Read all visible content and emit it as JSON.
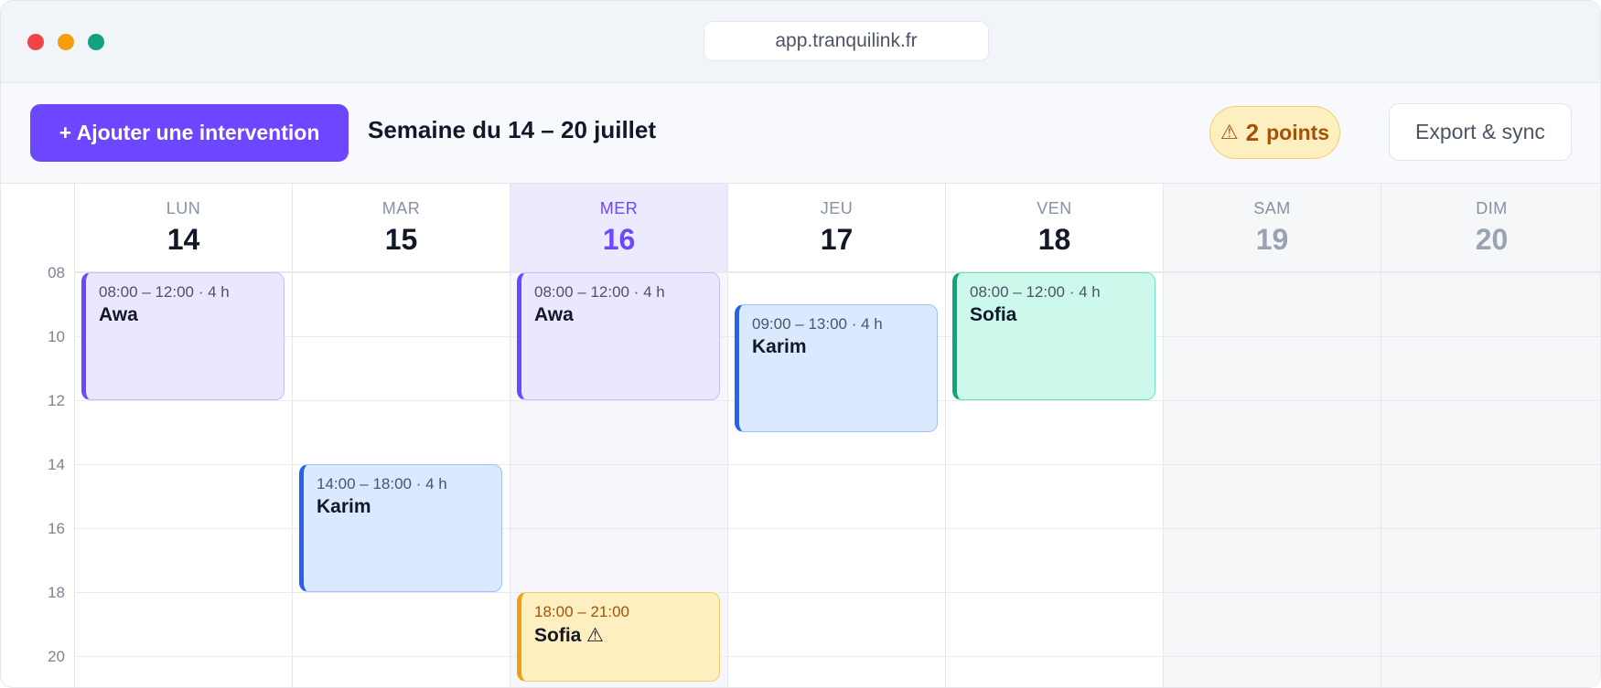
{
  "window": {
    "url": "app.tranquilink.fr"
  },
  "toolbar": {
    "add_label": "+ Ajouter une intervention",
    "week_title": "Semaine du 14 – 20 juillet",
    "alerts": {
      "icon": "warning-icon",
      "glyph": "⚠",
      "count": "2",
      "label": "points"
    },
    "export_label": "Export & sync"
  },
  "hours": [
    "08",
    "10",
    "12",
    "14",
    "16",
    "18",
    "20"
  ],
  "days": [
    {
      "name": "LUN",
      "num": "14"
    },
    {
      "name": "MAR",
      "num": "15"
    },
    {
      "name": "MER",
      "num": "16",
      "today": true
    },
    {
      "name": "JEU",
      "num": "17"
    },
    {
      "name": "VEN",
      "num": "18"
    },
    {
      "name": "SAM",
      "num": "19",
      "weekend": true
    },
    {
      "name": "DIM",
      "num": "20",
      "weekend": true
    }
  ],
  "events": [
    {
      "day": "LUN 14",
      "time": "08:00 – 12:00 · 4 h",
      "person": "Awa",
      "color": "#6c47ff"
    },
    {
      "day": "MAR 15",
      "time": "14:00 – 18:00 · 4 h",
      "person": "Karim",
      "color": "#2563eb"
    },
    {
      "day": "MER 16",
      "time": "08:00 – 12:00 · 4 h",
      "person": "Awa",
      "color": "#6c47ff"
    },
    {
      "day": "MER 16",
      "time": "18:00 – 21:00",
      "person": "Sofia ⚠",
      "color": "#f59e0b",
      "warning": true
    },
    {
      "day": "JEU 17",
      "time": "09:00 – 13:00 · 4 h",
      "person": "Karim",
      "color": "#2563eb"
    },
    {
      "day": "VEN 18",
      "time": "08:00 – 12:00 · 4 h",
      "person": "Sofia",
      "color": "#11a37f"
    }
  ],
  "colors": {
    "accent": "#6c47ff",
    "warning": "#f59e0b",
    "blue": "#2563eb",
    "teal": "#11a37f"
  }
}
